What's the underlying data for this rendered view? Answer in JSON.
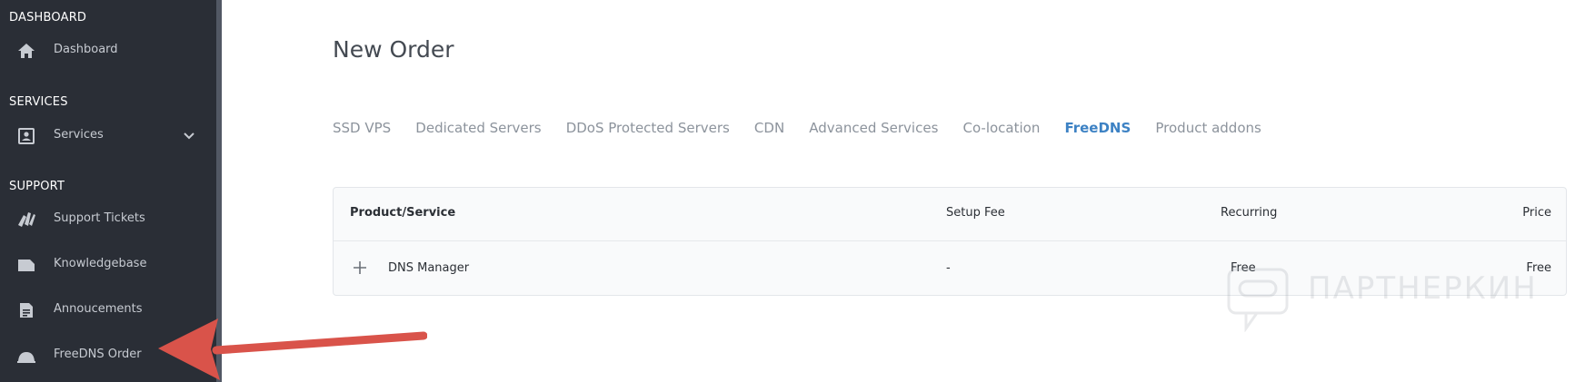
{
  "sidebar": {
    "sections": [
      {
        "heading": "DASHBOARD",
        "items": [
          {
            "label": "Dashboard",
            "icon": "home-icon"
          }
        ]
      },
      {
        "heading": "SERVICES",
        "items": [
          {
            "label": "Services",
            "icon": "user-card-icon",
            "expandable": true
          }
        ]
      },
      {
        "heading": "SUPPORT",
        "items": [
          {
            "label": "Support Tickets",
            "icon": "tickets-icon"
          },
          {
            "label": "Knowledgebase",
            "icon": "folder-icon"
          },
          {
            "label": "Annoucements",
            "icon": "document-icon"
          },
          {
            "label": "FreeDNS Order",
            "icon": "service-bell-icon"
          }
        ]
      }
    ]
  },
  "main": {
    "title": "New Order",
    "tabs": [
      {
        "label": "SSD VPS",
        "active": false
      },
      {
        "label": "Dedicated Servers",
        "active": false
      },
      {
        "label": "DDoS Protected Servers",
        "active": false
      },
      {
        "label": "CDN",
        "active": false
      },
      {
        "label": "Advanced Services",
        "active": false
      },
      {
        "label": "Co-location",
        "active": false
      },
      {
        "label": "FreeDNS",
        "active": true
      },
      {
        "label": "Product addons",
        "active": false
      }
    ],
    "table": {
      "headers": [
        "Product/Service",
        "Setup Fee",
        "Recurring",
        "Price"
      ],
      "rows": [
        {
          "product": "DNS Manager",
          "setup_fee": "-",
          "recurring": "Free",
          "price": "Free"
        }
      ]
    }
  },
  "watermark": {
    "text": "ПАРТНЕРКИН"
  },
  "colors": {
    "sidebar_bg": "#2a2e36",
    "active_tab": "#3d82c4",
    "arrow": "#d9534a"
  }
}
